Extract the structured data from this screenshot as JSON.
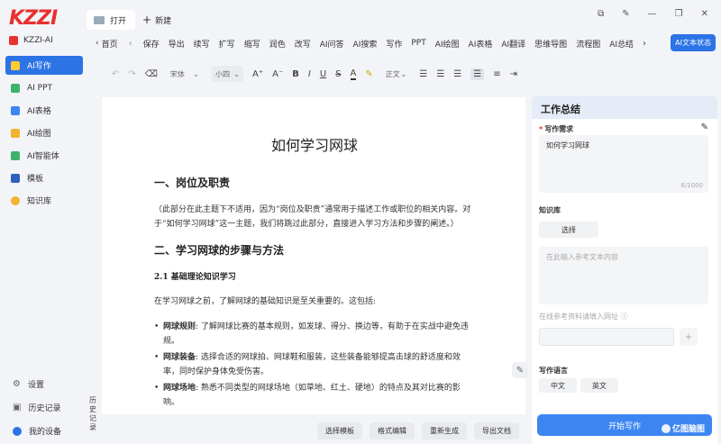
{
  "sidebar": {
    "logo": "KZZI",
    "brand": "KZZI-AI",
    "items": [
      {
        "label": "AI写作",
        "icon": "write-icon",
        "color": "#ffcc33",
        "active": true
      },
      {
        "label": "AI PPT",
        "icon": "ppt-icon",
        "color": "#3fb36b",
        "active": false
      },
      {
        "label": "AI表格",
        "icon": "table-icon",
        "color": "#3d86f2",
        "active": false
      },
      {
        "label": "AI绘图",
        "icon": "draw-icon",
        "color": "#f2b331",
        "active": false
      },
      {
        "label": "AI智能体",
        "icon": "agent-icon",
        "color": "#3fb36b",
        "active": false
      },
      {
        "label": "模板",
        "icon": "template-icon",
        "color": "#2f5fbf",
        "active": false
      },
      {
        "label": "知识库",
        "icon": "knowledge-icon",
        "color": "#f2b331",
        "active": false
      }
    ],
    "bottom": [
      {
        "label": "设置",
        "icon": "settings-icon"
      },
      {
        "label": "历史记录",
        "icon": "history-icon"
      },
      {
        "label": "我的设备",
        "icon": "device-icon"
      }
    ]
  },
  "history_vertical": "历史记录",
  "tabs": {
    "open_label": "打开",
    "new_label": "新建"
  },
  "window_controls": [
    "⧉",
    "✎",
    "—",
    "❐",
    "✕"
  ],
  "menu": {
    "home": "首页",
    "items": [
      "保存",
      "导出",
      "续写",
      "扩写",
      "缩写",
      "润色",
      "改写",
      "AI问答",
      "AI搜索",
      "写作",
      "PPT",
      "AI绘图",
      "AI表格",
      "AI翻译",
      "思维导图",
      "流程图",
      "AI总结"
    ],
    "ai_status": "AI文本状态"
  },
  "format": {
    "font_family": "宋体",
    "font_size": "小四",
    "paragraph": "正文"
  },
  "document": {
    "title": "如何学习网球",
    "h2_1": "一、岗位及职责",
    "p1": "（此部分在此主题下不适用，因为“岗位及职责”通常用于描述工作或职位的相关内容。对于“如何学习网球”这一主题，我们将跳过此部分，直接进入学习方法和步骤的阐述。）",
    "h2_2": "二、学习网球的步骤与方法",
    "h3_1": "2.1 基础理论知识学习",
    "p2": "在学习网球之前，了解网球的基础知识是至关重要的。这包括:",
    "list": [
      {
        "term": "网球规则",
        "text": ": 了解网球比赛的基本规则，如发球、得分、换边等，有助于在实战中避免违规。"
      },
      {
        "term": "网球装备",
        "text": ": 选择合适的网球拍、网球鞋和服装，这些装备能够提高击球的舒适度和效率，同时保护身体免受伤害。"
      },
      {
        "term": "网球场地",
        "text": ": 熟悉不同类型的网球场地（如草地、红土、硬地）的特点及其对比赛的影响。"
      }
    ]
  },
  "doc_actions": [
    "选择模板",
    "格式编辑",
    "重新生成",
    "导出文档"
  ],
  "panel": {
    "title": "工作总结",
    "req_label": "写作需求",
    "req_value": "如何学习网球",
    "req_count": "6/1000",
    "kb_label": "知识库",
    "choose": "选择",
    "ref_placeholder": "在此输入参考文本内容",
    "url_label": "在线参考资料请填入网址 ⓘ",
    "lang_label": "写作语言",
    "lang_zh": "中文",
    "lang_en": "英文",
    "start": "开始写作",
    "watermark": "亿图脑图"
  }
}
